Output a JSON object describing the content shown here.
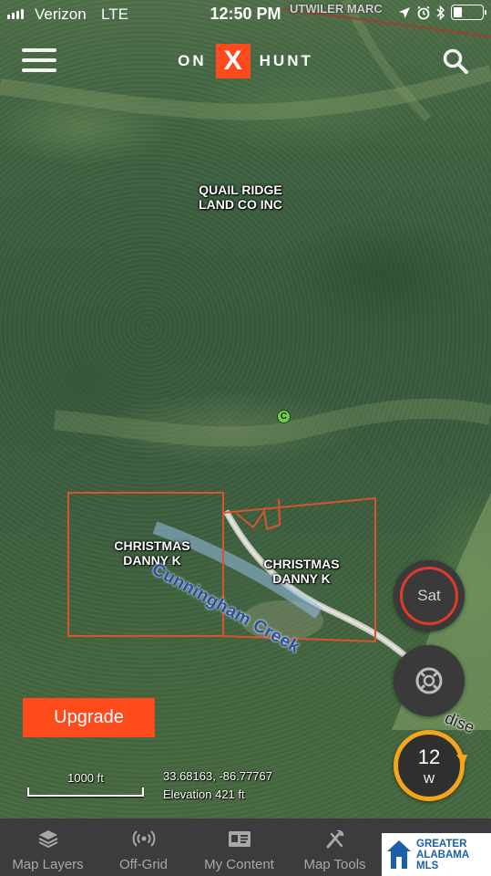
{
  "status_bar": {
    "carrier": "Verizon",
    "network": "LTE",
    "time": "12:50 PM",
    "battery_percent": 30
  },
  "header": {
    "logo_left": "ON",
    "logo_mark": "X",
    "logo_right": "HUNT"
  },
  "map": {
    "top_label": "UTWILER MARC",
    "parcels": [
      {
        "owner": "QUAIL RIDGE LAND CO INC"
      },
      {
        "owner": "CHRISTMAS DANNY K"
      },
      {
        "owner": "CHRISTMAS DANNY K"
      }
    ],
    "parcel_labels": {
      "quail_line1": "QUAIL RIDGE",
      "quail_line2": "LAND CO INC",
      "christmas_a_line1": "CHRISTMAS",
      "christmas_a_line2": "DANNY K",
      "christmas_b_line1": "CHRISTMAS",
      "christmas_b_line2": "DANNY K"
    },
    "creek_label": "Cunningham Creek",
    "road_label": "dise",
    "waypoint_letter": "C",
    "boundary_color": "#d9532f"
  },
  "controls": {
    "sat_label": "Sat",
    "compass_value": "12",
    "compass_direction": "W",
    "upgrade_label": "Upgrade"
  },
  "scale": {
    "label": "1000 ft"
  },
  "location": {
    "coordinates": "33.68163, -86.77767",
    "elevation": "Elevation 421 ft"
  },
  "bottom_nav": {
    "items": [
      {
        "label": "Map Layers",
        "icon": "layers-icon"
      },
      {
        "label": "Off-Grid",
        "icon": "broadcast-icon"
      },
      {
        "label": "My Content",
        "icon": "id-card-icon"
      },
      {
        "label": "Map Tools",
        "icon": "tools-icon"
      }
    ]
  },
  "watermark": {
    "line1": "GREATER",
    "line2": "ALABAMA",
    "line3": "MLS"
  },
  "colors": {
    "brand_orange": "#ff4a1c",
    "compass_ring": "#f4a51c",
    "sat_ring": "#e03a2a",
    "nav_background": "#3c3c3c"
  }
}
